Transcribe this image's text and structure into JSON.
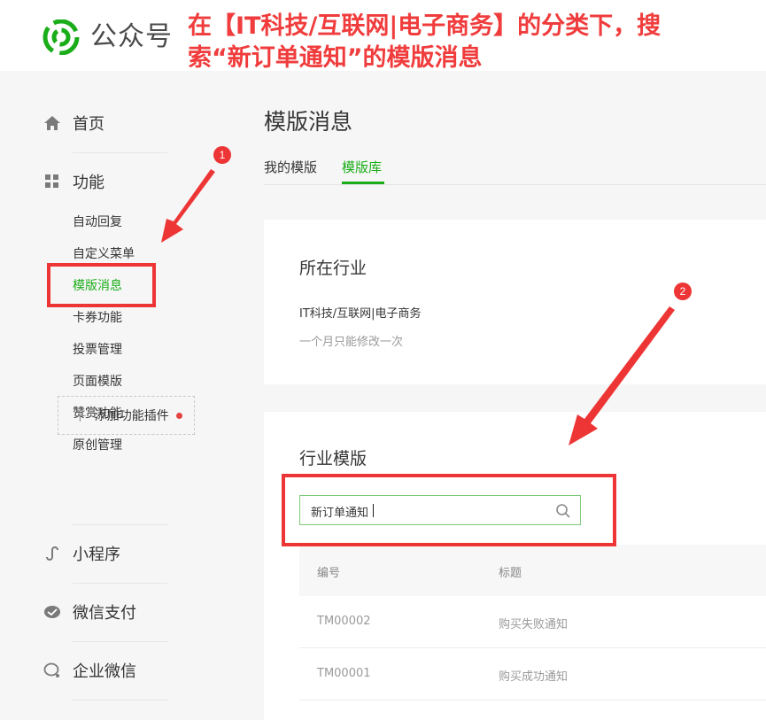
{
  "brand": {
    "name": "公众号"
  },
  "annotation": {
    "title": "在【IT科技/互联网|电子商务】的分类下，搜索“新订单通知”的模版消息",
    "badge1": "1",
    "badge2": "2",
    "color": "#ee3535"
  },
  "sidebar": {
    "home": "首页",
    "features": "功能",
    "sub_items": [
      "自动回复",
      "自定义菜单",
      "模版消息",
      "卡券功能",
      "投票管理",
      "页面模版",
      "赞赏功能",
      "原创管理"
    ],
    "add_plugin": "添加功能插件",
    "mini_program": "小程序",
    "wechat_pay": "微信支付",
    "work_wechat": "企业微信"
  },
  "main": {
    "title": "模版消息",
    "tabs": [
      "我的模版",
      "模版库"
    ],
    "industry": {
      "heading": "所在行业",
      "value": "IT科技/互联网|电子商务",
      "tip": "一个月只能修改一次"
    },
    "templates": {
      "heading": "行业模版",
      "search_value": "新订单通知",
      "columns": [
        "编号",
        "标题"
      ],
      "rows": [
        {
          "id": "TM00002",
          "title": "购买失败通知"
        },
        {
          "id": "TM00001",
          "title": "购买成功通知"
        }
      ]
    }
  },
  "colors": {
    "accent": "#1aad19",
    "annotation": "#ee3535"
  }
}
